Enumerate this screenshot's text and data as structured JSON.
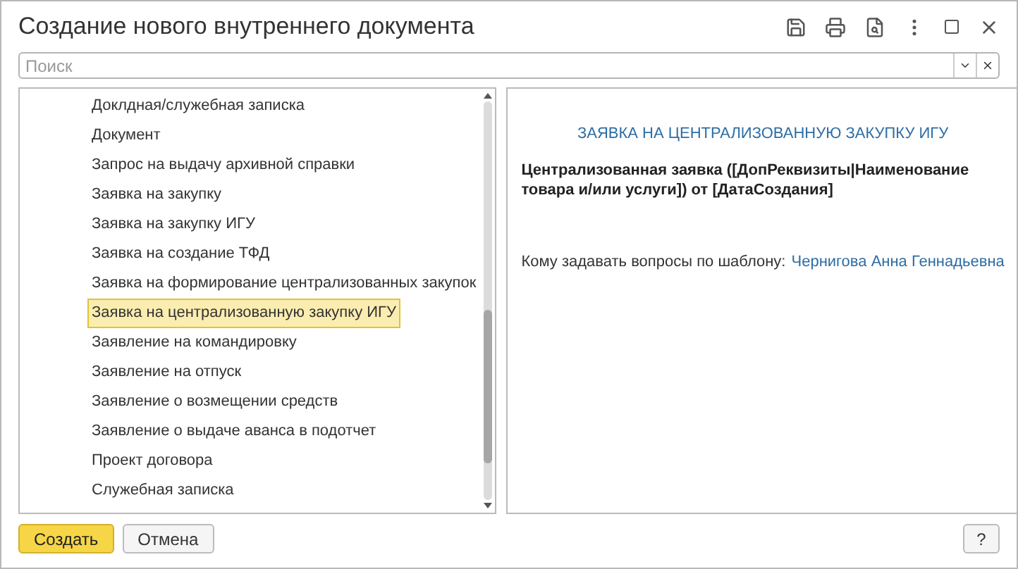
{
  "window": {
    "title": "Создание нового внутреннего документа"
  },
  "search": {
    "placeholder": "Поиск"
  },
  "list": {
    "items": [
      {
        "label": "Доклдная/служебная записка",
        "selected": false
      },
      {
        "label": "Документ",
        "selected": false
      },
      {
        "label": "Запрос на выдачу архивной справки",
        "selected": false
      },
      {
        "label": "Заявка на закупку",
        "selected": false
      },
      {
        "label": "Заявка на закупку ИГУ",
        "selected": false
      },
      {
        "label": "Заявка на создание ТФД",
        "selected": false
      },
      {
        "label": "Заявка на формирование централизованных закупок",
        "selected": false
      },
      {
        "label": "Заявка на централизованную закупку ИГУ",
        "selected": true
      },
      {
        "label": "Заявление на командировку",
        "selected": false
      },
      {
        "label": "Заявление на отпуск",
        "selected": false
      },
      {
        "label": "Заявление о возмещении средств",
        "selected": false
      },
      {
        "label": "Заявление о выдаче аванса в подотчет",
        "selected": false
      },
      {
        "label": "Проект договора",
        "selected": false
      },
      {
        "label": "Служебная записка",
        "selected": false
      }
    ]
  },
  "preview": {
    "heading": "ЗАЯВКА НА ЦЕНТРАЛИЗОВАННУЮ ЗАКУПКУ ИГУ",
    "name_template": "Централизованная заявка ([ДопРеквизиты|Наименование товара и/или услуги]) от [ДатаСоздания]",
    "contact_label": "Кому задавать вопросы по шаблону:",
    "contact_name": "Чернигова Анна Геннадьевна"
  },
  "buttons": {
    "create": "Создать",
    "cancel": "Отмена",
    "help": "?"
  }
}
